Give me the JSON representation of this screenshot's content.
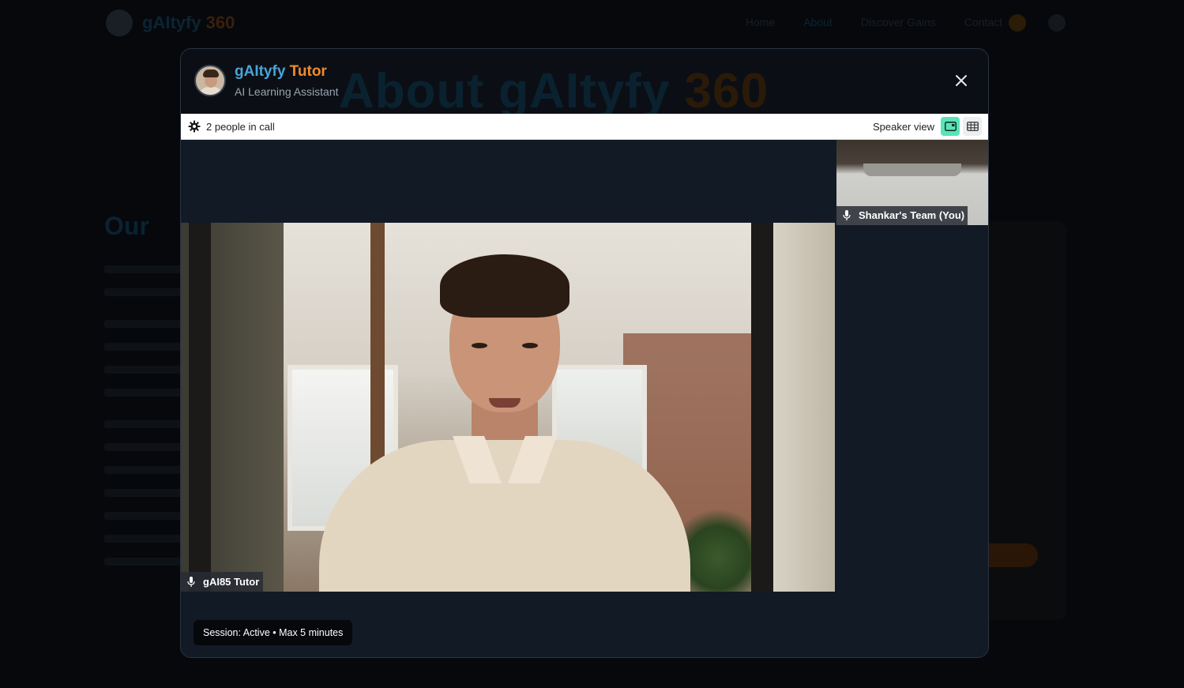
{
  "modal": {
    "title_main": "gAItyfy",
    "title_accent": " Tutor",
    "subtitle": "AI Learning Assistant",
    "background_title_main": "About gAItyfy",
    "background_title_accent": " 360"
  },
  "toolbar": {
    "people_count": "2 people in call",
    "view_label": "Speaker view"
  },
  "participants": {
    "main_name": "gAI85 Tutor",
    "self_name": "Shankar's Team (You)"
  },
  "session": {
    "status": "Session: Active • Max 5 minutes"
  },
  "colors": {
    "brand_blue": "#4ba3d6",
    "brand_orange": "#f28a2e",
    "active_view": "#5be3b8",
    "modal_bg": "#121a26"
  }
}
